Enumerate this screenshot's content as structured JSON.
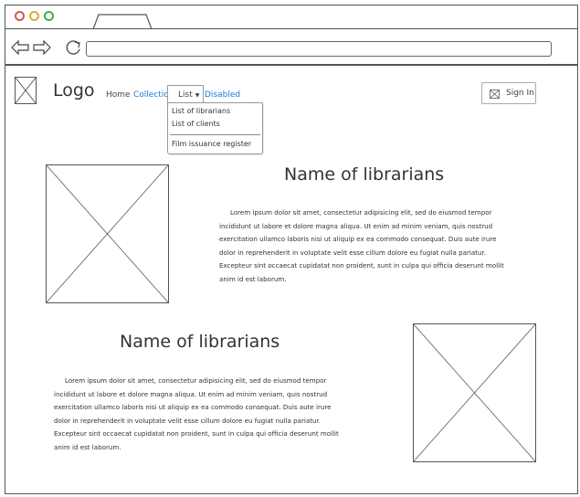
{
  "browser": {},
  "header": {
    "logo_text": "Logo",
    "nav": {
      "home": "Home",
      "collection": "Collection",
      "list": "List",
      "disabled": "Disabled"
    },
    "dropdown": {
      "items": [
        "List of librarians",
        "List of clients",
        "Film issuance register"
      ]
    },
    "signin_label": "Sign In"
  },
  "sections": [
    {
      "heading": "Name of librarians",
      "paragraph": "Lorem ipsum dolor sit amet, consectetur adipisicing elit, sed do eiusmod tempor incididunt ut labore et dolore magna aliqua. Ut enim ad minim veniam, quis nostrud exercitation ullamco laboris nisi ut aliquip ex ea commodo consequat. Duis aute irure dolor in reprehenderit in voluptate velit esse cillum dolore eu fugiat nulla pariatur. Excepteur sint occaecat cupidatat non proident, sunt in culpa qui officia deserunt mollit anim id est laborum."
    },
    {
      "heading": "Name of librarians",
      "paragraph": "Lorem ipsum dolor sit amet, consectetur adipisicing elit, sed do eiusmod tempor incididunt ut labore et dolore magna aliqua. Ut enim ad minim veniam, quis nostrud exercitation ullamco laboris nisi ut aliquip ex ea commodo consequat. Duis aute irure dolor in reprehenderit in voluptate velit esse cillum dolore eu fugiat nulla pariatur. Excepteur sint occaecat cupidatat non proident, sunt in culpa qui officia deserunt mollit anim id est laborum."
    }
  ],
  "colors": {
    "link": "#1a7ad4",
    "close_dot": "#d9534f",
    "minimize_dot": "#e8a33a",
    "maximize_dot": "#3fae49",
    "line": "#555555"
  },
  "icons": [
    "back-arrow-icon",
    "forward-arrow-icon",
    "reload-icon",
    "image-placeholder-icon",
    "signin-icon"
  ]
}
